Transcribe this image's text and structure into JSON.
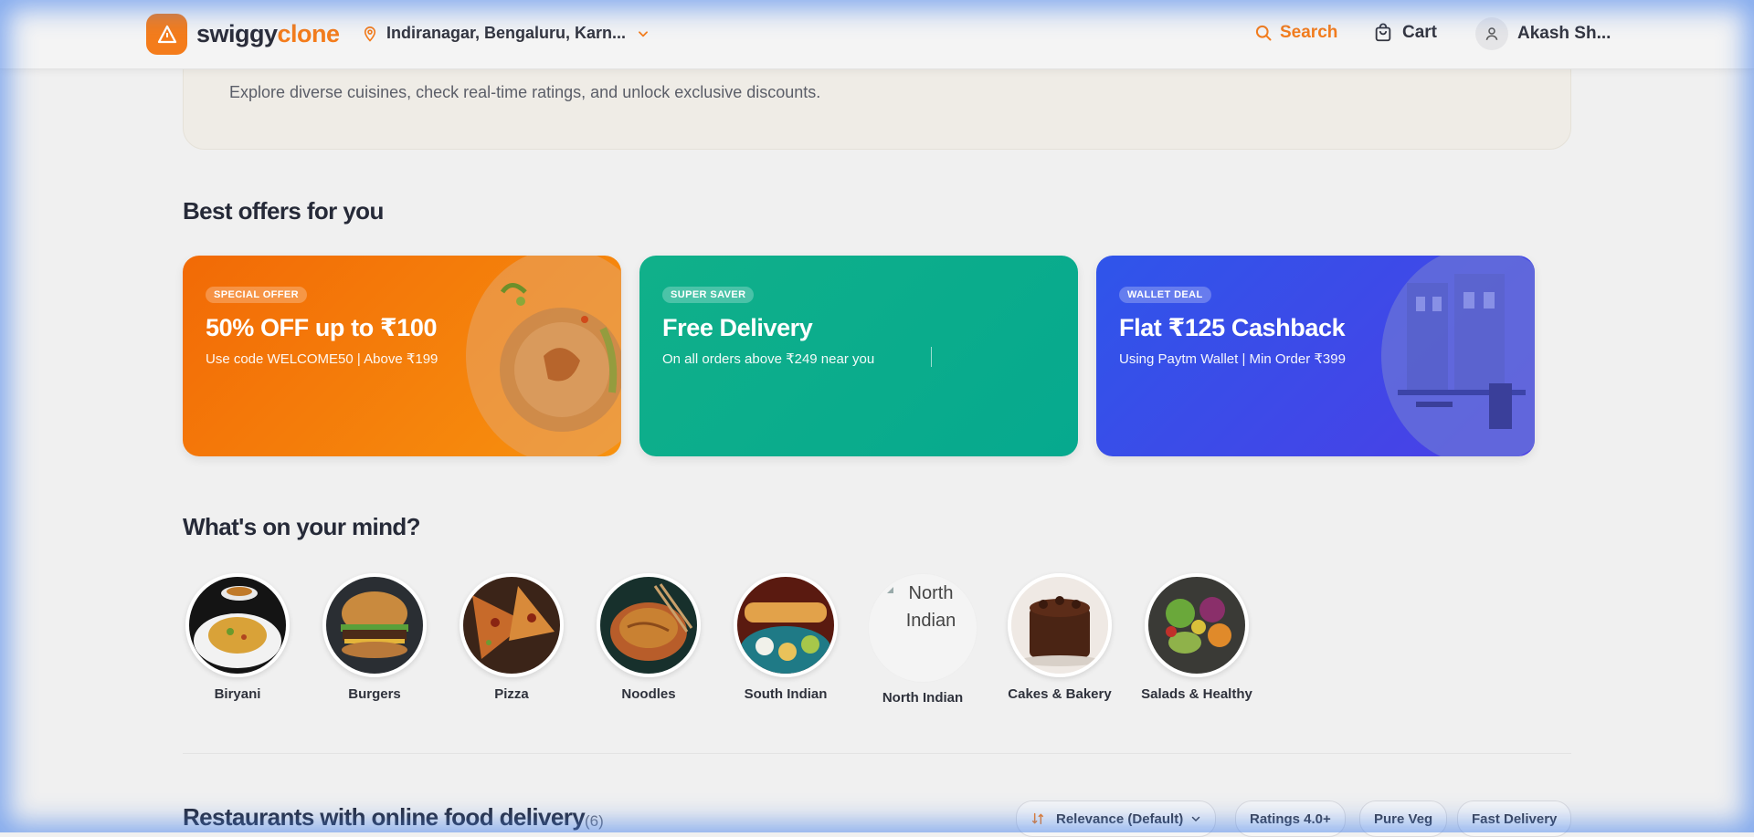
{
  "header": {
    "brand_part1": "swiggy",
    "brand_part2": "clone",
    "location": "Indiranagar, Bengaluru, Karn...",
    "search_label": "Search",
    "cart_label": "Cart",
    "user_name": "Akash Sh...",
    "icons": {
      "logo": "triangle-logo-icon",
      "location": "map-pin-icon",
      "chevron": "chevron-down-icon",
      "search": "search-icon",
      "cart": "shopping-bag-icon",
      "user": "user-icon"
    }
  },
  "hero": {
    "subtitle": "Explore diverse cuisines, check real-time ratings, and unlock exclusive discounts."
  },
  "offers": {
    "heading": "Best offers for you",
    "items": [
      {
        "badge": "SPECIAL OFFER",
        "title": "50% OFF up to ₹100",
        "description": "Use code WELCOME50 | Above ₹199",
        "color": "#f47c1b"
      },
      {
        "badge": "SUPER SAVER",
        "title": "Free Delivery",
        "description": "On all orders above ₹249 near you",
        "color": "#0fb08c"
      },
      {
        "badge": "WALLET DEAL",
        "title": "Flat ₹125 Cashback",
        "description": "Using Paytm Wallet | Min Order ₹399",
        "color": "#3a4fe8"
      }
    ]
  },
  "categories": {
    "heading": "What's on your mind?",
    "items": [
      {
        "label": "Biryani"
      },
      {
        "label": "Burgers"
      },
      {
        "label": "Pizza"
      },
      {
        "label": "Noodles"
      },
      {
        "label": "South Indian"
      },
      {
        "label": "North Indian",
        "alt_text": "North Indian"
      },
      {
        "label": "Cakes & Bakery"
      },
      {
        "label": "Salads & Healthy"
      }
    ]
  },
  "restaurants": {
    "heading": "Restaurants with online food delivery",
    "count": "(6)",
    "filters": {
      "sort_label": "Relevance (Default)",
      "ratings": "Ratings 4.0+",
      "veg": "Pure Veg",
      "fast": "Fast Delivery"
    }
  },
  "colors": {
    "accent": "#f47c1b",
    "text_dark": "#262a38"
  }
}
